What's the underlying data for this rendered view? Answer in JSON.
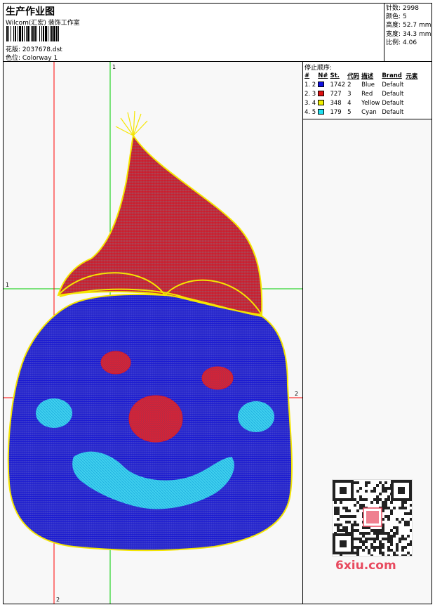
{
  "header": {
    "title": "生产作业图",
    "subtitle": "Wilcom(汇宏) 装饰工作室",
    "design_label": "花版:",
    "design_value": "2037678.dst",
    "colorway_label": "色位:",
    "colorway_value": "Colorway 1"
  },
  "stats": {
    "stitches_label": "针数:",
    "stitches": "2998",
    "colors_label": "颜色:",
    "colors": "5",
    "height_label": "高度:",
    "height": "52.7 mm",
    "width_label": "宽度:",
    "width": "34.3 mm",
    "scale_label": "比例:",
    "scale": "4.06"
  },
  "stop_sequence": {
    "title": "停止顺序:",
    "headers": [
      "#",
      "N#",
      "St.",
      "代码",
      "描述",
      "Brand",
      "元素"
    ],
    "rows": [
      {
        "idx": "1.",
        "n": "2",
        "color": "#1010e0",
        "st": "1742",
        "code": "2",
        "desc": "Blue",
        "brand": "Default"
      },
      {
        "idx": "2.",
        "n": "3",
        "color": "#e01010",
        "st": "727",
        "code": "3",
        "desc": "Red",
        "brand": "Default"
      },
      {
        "idx": "3.",
        "n": "4",
        "color": "#f0f000",
        "st": "348",
        "code": "4",
        "desc": "Yellow",
        "brand": "Default"
      },
      {
        "idx": "4.",
        "n": "5",
        "color": "#20e0f0",
        "st": "179",
        "code": "5",
        "desc": "Cyan",
        "brand": "Default"
      }
    ]
  },
  "canvas": {
    "guide_labels": {
      "v1": "1",
      "h1": "1",
      "h2": "2",
      "v2": "2"
    },
    "colors": {
      "blue": "#1a1ad8",
      "red": "#d81a2a",
      "yellow": "#f5e600",
      "cyan": "#33d8ee",
      "green": "#00cc00",
      "redline": "#ff0000"
    }
  },
  "watermark": {
    "site": "6xiu.com"
  }
}
